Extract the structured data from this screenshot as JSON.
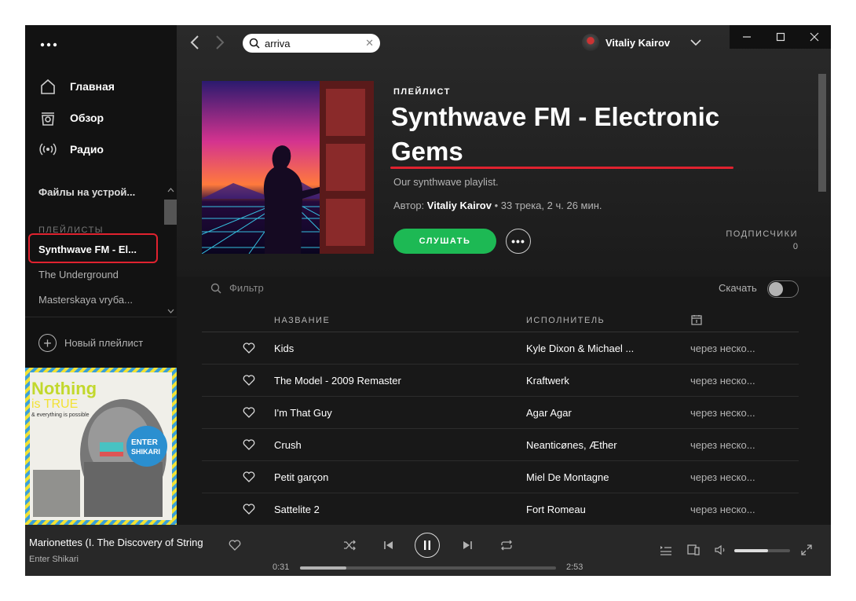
{
  "colors": {
    "accent": "#1db954",
    "highlight": "#e0222f",
    "background": "#181818",
    "sidebar": "#121212"
  },
  "sidebar": {
    "menu_icon": "ellipsis",
    "nav": [
      {
        "label": "Главная",
        "icon": "home-icon"
      },
      {
        "label": "Обзор",
        "icon": "browse-icon"
      },
      {
        "label": "Радио",
        "icon": "radio-icon"
      }
    ],
    "local_files": "Файлы на устрой...",
    "playlists_heading": "ПЛЕЙЛИСТЫ",
    "playlists": [
      "Synthwave FM - El...",
      "The Underground",
      "Masterskaya vrуба..."
    ],
    "new_playlist": "Новый плейлист"
  },
  "topbar": {
    "search_value": "arriva",
    "user_name": "Vitaliy Kairov"
  },
  "playlist": {
    "type": "ПЛЕЙЛИСТ",
    "title": "Synthwave FM - Electronic Gems",
    "description": "Our synthwave playlist.",
    "author_prefix": "Автор:",
    "author": "Vitaliy Kairov",
    "stats": "• 33 трека, 2 ч. 26 мин.",
    "play_label": "СЛУШАТЬ",
    "more_label": "•••",
    "followers_label": "ПОДПИСЧИКИ",
    "followers_count": "0",
    "filter_placeholder": "Фильтр",
    "download_label": "Скачать",
    "download_enabled": false
  },
  "table": {
    "columns": {
      "title": "НАЗВАНИЕ",
      "artist": "ИСПОЛНИТЕЛЬ",
      "date_icon": "calendar-icon"
    },
    "rows": [
      {
        "title": "Kids",
        "artist": "Kyle Dixon & Michael ...",
        "date": "через неско..."
      },
      {
        "title": "The Model - 2009 Remaster",
        "artist": "Kraftwerk",
        "date": "через неско..."
      },
      {
        "title": "I'm That Guy",
        "artist": "Agar Agar",
        "date": "через неско..."
      },
      {
        "title": "Crush",
        "artist": "Neanticønes, Æther",
        "date": "через неско..."
      },
      {
        "title": "Petit garçon",
        "artist": "Miel De Montagne",
        "date": "через неско..."
      },
      {
        "title": "Sattelite 2",
        "artist": "Fort Romeau",
        "date": "через неско..."
      }
    ]
  },
  "now_playing": {
    "title": "Marionettes (I. The Discovery of String",
    "artist": "Enter Shikari",
    "time_current": "0:31",
    "time_total": "2:53",
    "progress": 0.18,
    "volume": 0.6,
    "album_art": {
      "line1": "Nothing",
      "line2": "is TRUE",
      "line3": "& everything is possible",
      "badge1": "ENTER",
      "badge2": "SHIKARI"
    }
  }
}
